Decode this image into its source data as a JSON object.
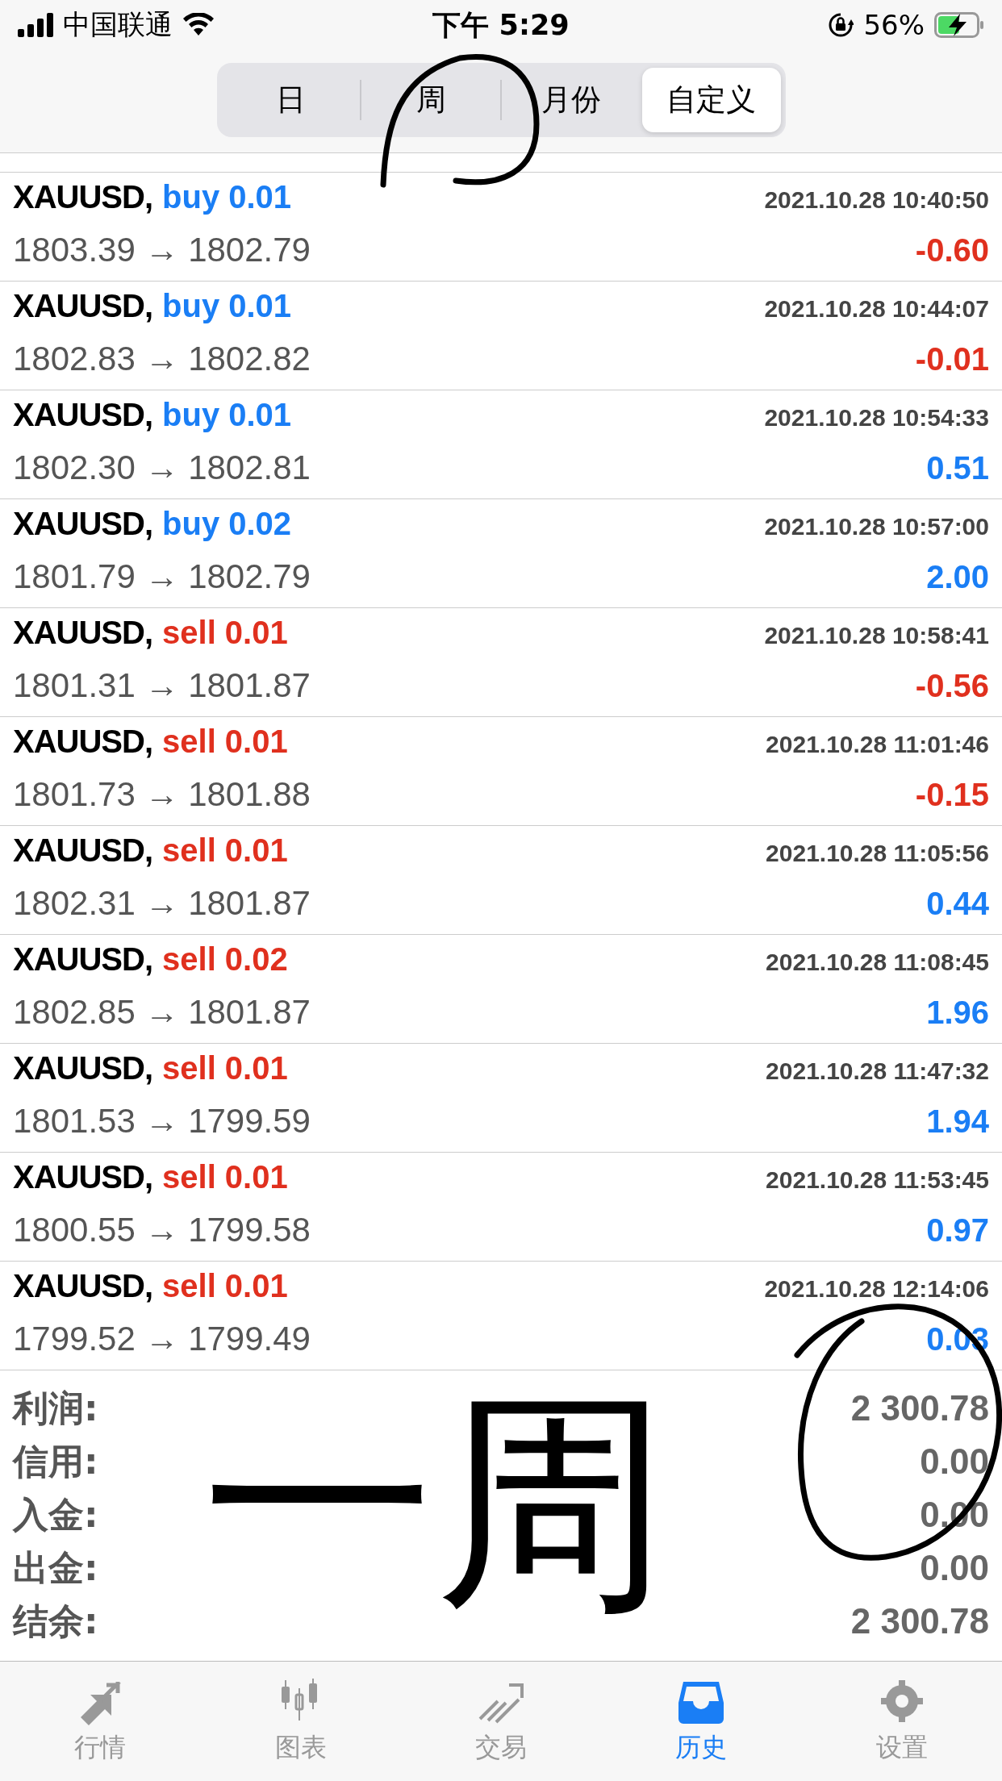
{
  "status_bar": {
    "carrier": "中国联通",
    "time": "下午 5:29",
    "battery": "56%"
  },
  "period_tabs": [
    {
      "label": "日",
      "selected": false
    },
    {
      "label": "周",
      "selected": false
    },
    {
      "label": "月份",
      "selected": false
    },
    {
      "label": "自定义",
      "selected": true
    }
  ],
  "deals": [
    {
      "symbol": "XAUUSD,",
      "color": "#1a7ef5",
      "volume": "buy 0.01",
      "time": "2021.10.28 10:40:50",
      "prices": "1803.39 → 1802.79",
      "profit": "-0.60",
      "loss": true
    },
    {
      "symbol": "XAUUSD,",
      "color": "#1a7ef5",
      "volume": "buy 0.01",
      "time": "2021.10.28 10:44:07",
      "prices": "1802.83 → 1802.82",
      "profit": "-0.01",
      "loss": true
    },
    {
      "symbol": "XAUUSD,",
      "color": "#1a7ef5",
      "volume": "buy 0.01",
      "time": "2021.10.28 10:54:33",
      "prices": "1802.30 → 1802.81",
      "profit": "0.51",
      "loss": false
    },
    {
      "symbol": "XAUUSD,",
      "color": "#1a7ef5",
      "volume": "buy 0.02",
      "time": "2021.10.28 10:57:00",
      "prices": "1801.79 → 1802.79",
      "profit": "2.00",
      "loss": false
    },
    {
      "symbol": "XAUUSD,",
      "color": "#e0301e",
      "volume": "sell 0.01",
      "time": "2021.10.28 10:58:41",
      "prices": "1801.31 → 1801.87",
      "profit": "-0.56",
      "loss": true
    },
    {
      "symbol": "XAUUSD,",
      "color": "#e0301e",
      "volume": "sell 0.01",
      "time": "2021.10.28 11:01:46",
      "prices": "1801.73 → 1801.88",
      "profit": "-0.15",
      "loss": true
    },
    {
      "symbol": "XAUUSD,",
      "color": "#e0301e",
      "volume": "sell 0.01",
      "time": "2021.10.28 11:05:56",
      "prices": "1802.31 → 1801.87",
      "profit": "0.44",
      "loss": false
    },
    {
      "symbol": "XAUUSD,",
      "color": "#e0301e",
      "volume": "sell 0.02",
      "time": "2021.10.28 11:08:45",
      "prices": "1802.85 → 1801.87",
      "profit": "1.96",
      "loss": false
    },
    {
      "symbol": "XAUUSD,",
      "color": "#e0301e",
      "volume": "sell 0.01",
      "time": "2021.10.28 11:47:32",
      "prices": "1801.53 → 1799.59",
      "profit": "1.94",
      "loss": false
    },
    {
      "symbol": "XAUUSD,",
      "color": "#e0301e",
      "volume": "sell 0.01",
      "time": "2021.10.28 11:53:45",
      "prices": "1800.55 → 1799.58",
      "profit": "0.97",
      "loss": false
    },
    {
      "symbol": "XAUUSD,",
      "color": "#e0301e",
      "volume": "sell 0.01",
      "time": "2021.10.28 12:14:06",
      "prices": "1799.52 → 1799.49",
      "profit": "0.03",
      "loss": false
    }
  ],
  "summary": [
    {
      "label": "利润:",
      "value": "2 300.78"
    },
    {
      "label": "信用:",
      "value": "0.00"
    },
    {
      "label": "入金:",
      "value": "0.00"
    },
    {
      "label": "出金:",
      "value": "0.00"
    },
    {
      "label": "结余:",
      "value": "2 300.78"
    }
  ],
  "handwritten_note": "一周",
  "tab_bar": [
    {
      "kind": "quotes",
      "label": "行情",
      "selected": false
    },
    {
      "kind": "chart",
      "label": "图表",
      "selected": false
    },
    {
      "kind": "trade",
      "label": "交易",
      "selected": false
    },
    {
      "kind": "history",
      "label": "历史",
      "selected": true
    },
    {
      "kind": "settings",
      "label": "设置",
      "selected": false
    }
  ]
}
